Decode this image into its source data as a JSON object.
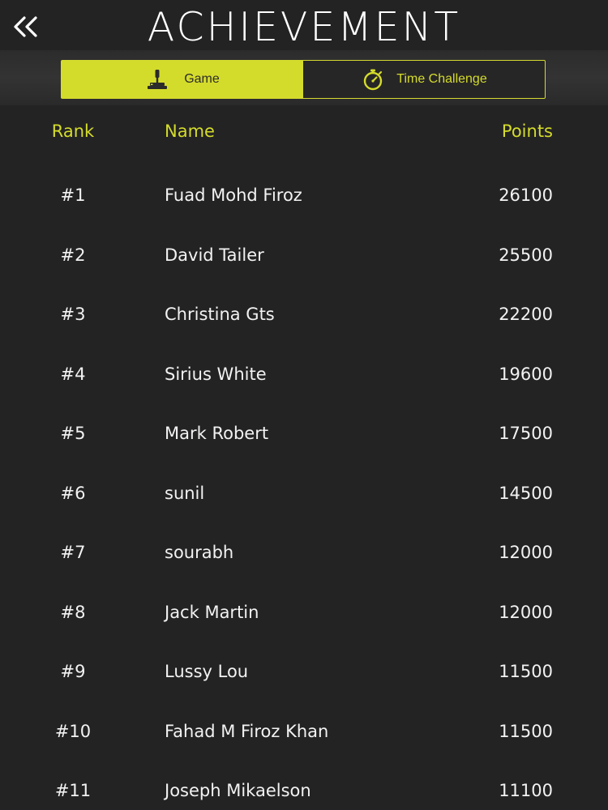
{
  "header": {
    "title": "ACHIEVEMENT",
    "back_icon": "double-chevron-left-icon"
  },
  "tabs": [
    {
      "label": "Game",
      "icon": "joystick-icon",
      "active": true
    },
    {
      "label": "Time Challenge",
      "icon": "stopwatch-icon",
      "active": false
    }
  ],
  "colors": {
    "accent": "#d4dc2b",
    "background": "#242324",
    "text": "#f2f2f2"
  },
  "leaderboard": {
    "columns": {
      "rank": "Rank",
      "name": "Name",
      "points": "Points"
    },
    "rows": [
      {
        "rank": "#1",
        "name": "Fuad Mohd Firoz",
        "points": "26100"
      },
      {
        "rank": "#2",
        "name": "David Tailer",
        "points": "25500"
      },
      {
        "rank": "#3",
        "name": "Christina Gts",
        "points": "22200"
      },
      {
        "rank": "#4",
        "name": "Sirius White",
        "points": "19600"
      },
      {
        "rank": "#5",
        "name": "Mark Robert",
        "points": "17500"
      },
      {
        "rank": "#6",
        "name": "sunil",
        "points": "14500"
      },
      {
        "rank": "#7",
        "name": "sourabh",
        "points": "12000"
      },
      {
        "rank": "#8",
        "name": "Jack Martin",
        "points": "12000"
      },
      {
        "rank": "#9",
        "name": "Lussy Lou",
        "points": "11500"
      },
      {
        "rank": "#10",
        "name": "Fahad M Firoz Khan",
        "points": "11500"
      },
      {
        "rank": "#11",
        "name": "Joseph Mikaelson",
        "points": "11100"
      }
    ]
  }
}
